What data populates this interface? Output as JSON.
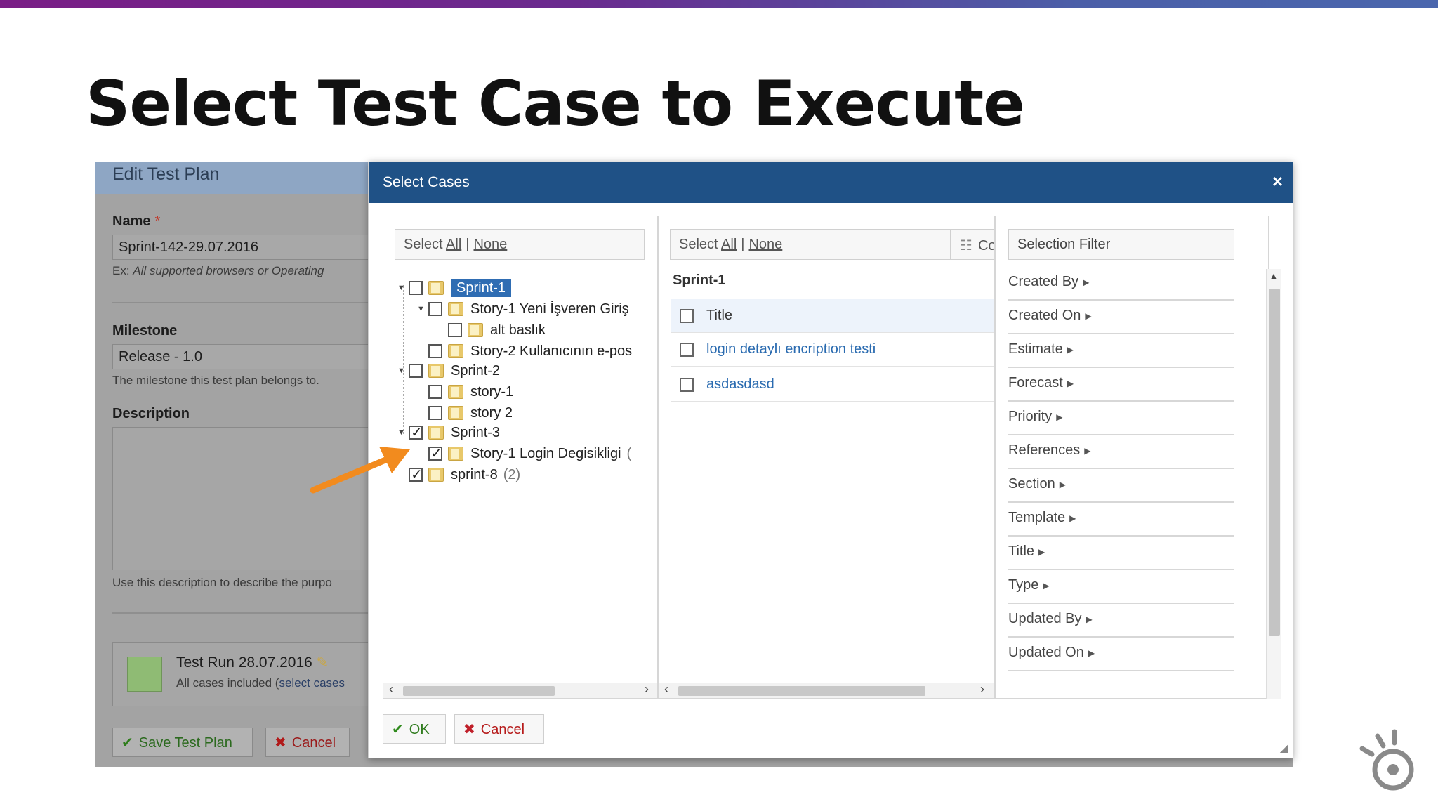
{
  "slide": {
    "title": "Select Test Case to Execute"
  },
  "edit_panel": {
    "title": "Edit Test Plan",
    "name_label": "Name",
    "required_mark": "*",
    "name_value": "Sprint-142-29.07.2016",
    "name_hint_prefix": "Ex:",
    "name_hint_italic": "All supported browsers or Operating",
    "milestone_label": "Milestone",
    "milestone_value": "Release - 1.0",
    "milestone_hint": "The milestone this test plan belongs to.",
    "description_label": "Description",
    "description_hint": "Use this description to describe the purpo",
    "run_title": "Test Run 28.07.2016",
    "run_sub_prefix": "All cases included (",
    "run_sub_link": "select cases",
    "save_button": "Save Test Plan",
    "cancel_button": "Cancel"
  },
  "modal": {
    "title": "Select Cases",
    "close_icon": "×",
    "tree_selbar": {
      "select": "Select",
      "all": "All",
      "sep": "|",
      "none": "None"
    },
    "tree": [
      {
        "label": "Sprint-1",
        "level": 0,
        "checked": false,
        "selected": true,
        "expanded": true
      },
      {
        "label": "Story-1 Yeni İşveren Giriş",
        "level": 1,
        "checked": false,
        "expanded": true
      },
      {
        "label": "alt baslık",
        "level": 2,
        "checked": false
      },
      {
        "label": "Story-2 Kullanıcının e-pos",
        "level": 1,
        "checked": false
      },
      {
        "label": "Sprint-2",
        "level": 0,
        "checked": false,
        "expanded": true
      },
      {
        "label": "story-1",
        "level": 1,
        "checked": false
      },
      {
        "label": "story 2",
        "level": 1,
        "checked": false
      },
      {
        "label": "Sprint-3",
        "level": 0,
        "checked": true,
        "expanded": true
      },
      {
        "label": "Story-1 Login Degisikligi",
        "level": 1,
        "checked": true,
        "count": "("
      },
      {
        "label": "sprint-8",
        "level": 0,
        "checked": true,
        "count": "(2)"
      }
    ],
    "cases_selbar": {
      "select": "Select",
      "all": "All",
      "sep": "|",
      "none": "None"
    },
    "column_button": "Col",
    "cases_group": "Sprint-1",
    "cases_header": "Title",
    "cases": [
      "login detaylı encription testi",
      "asdasdasd"
    ],
    "filter_title": "Selection Filter",
    "filters": [
      "Created By",
      "Created On",
      "Estimate",
      "Forecast",
      "Priority",
      "References",
      "Section",
      "Template",
      "Title",
      "Type",
      "Updated By",
      "Updated On"
    ],
    "ok_button": "OK",
    "cancel_button": "Cancel"
  },
  "icons": {
    "check": "check-icon",
    "cross": "cross-icon",
    "folder": "folder-icon",
    "pencil": "pencil-icon",
    "columns": "columns-icon",
    "arrow": "annotation-arrow-icon",
    "logo": "brand-logo-icon"
  },
  "colors": {
    "modal_header": "#1f5186",
    "selected": "#2f6db3",
    "link": "#2a6bb0",
    "arrow": "#f28b1e",
    "ok_green": "#2f8a1c",
    "cancel_red": "#c0202a"
  }
}
